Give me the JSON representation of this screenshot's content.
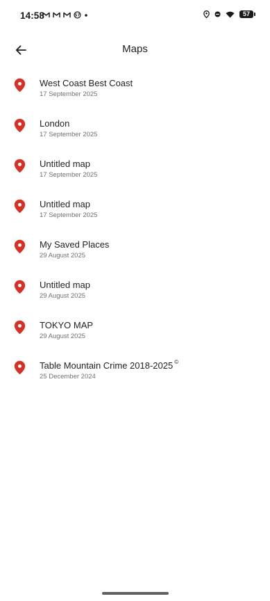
{
  "status_bar": {
    "time": "14:58",
    "notification_icons": [
      "gmail-icon",
      "gmail-icon",
      "gmail-icon",
      "data-saver-icon"
    ],
    "battery_level": "57"
  },
  "app_bar": {
    "title": "Maps",
    "back_icon": "arrow-back-icon"
  },
  "maps": [
    {
      "title": "West Coast Best Coast",
      "date": "17 September 2025"
    },
    {
      "title": "London",
      "date": "17 September 2025"
    },
    {
      "title": "Untitled map",
      "date": "17 September 2025"
    },
    {
      "title": "Untitled map",
      "date": "17 September 2025"
    },
    {
      "title": "My Saved Places",
      "date": "29 August 2025"
    },
    {
      "title": "Untitled map",
      "date": "29 August 2025"
    },
    {
      "title": "TOKYO MAP",
      "date": "29 August 2025"
    },
    {
      "title": "Table Mountain Crime 2018-2025",
      "title_mark": "©",
      "date": "25 December 2024"
    }
  ],
  "colors": {
    "pin": "#d93025",
    "title_text": "#1f1f1f",
    "date_text": "#6f6f6f"
  }
}
